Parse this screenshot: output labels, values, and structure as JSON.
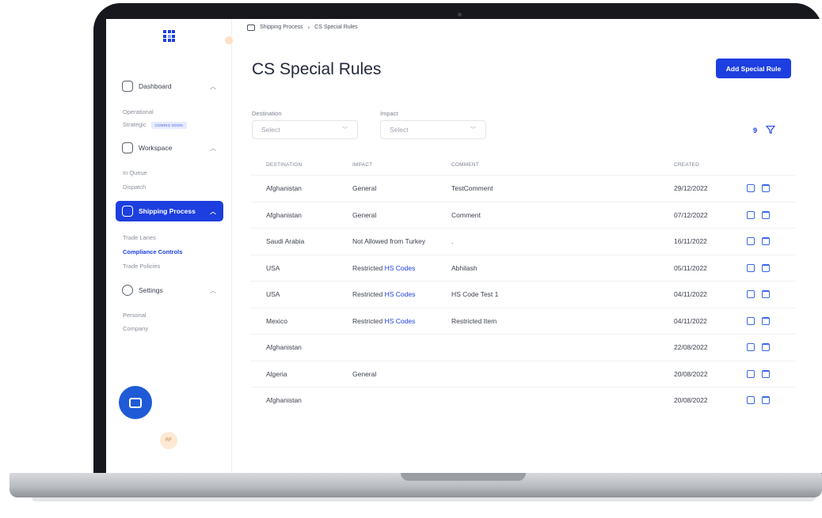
{
  "breadcrumb": {
    "parent": "Shipping Process",
    "current": "CS Special Rules"
  },
  "page": {
    "title": "CS Special Rules",
    "add_button": "Add Special Rule"
  },
  "sidebar": {
    "groups": [
      {
        "label": "Dashboard",
        "icon": "home-icon",
        "items": [
          {
            "label": "Operational"
          },
          {
            "label": "Strategic",
            "badge": "COMING SOON"
          }
        ]
      },
      {
        "label": "Workspace",
        "icon": "document-icon",
        "items": [
          {
            "label": "In Queue"
          },
          {
            "label": "Dispatch"
          }
        ]
      },
      {
        "label": "Shipping Process",
        "icon": "shipping-icon",
        "active": true,
        "items": [
          {
            "label": "Trade Lanes"
          },
          {
            "label": "Compliance Controls",
            "current": true
          },
          {
            "label": "Trade Policies"
          }
        ]
      },
      {
        "label": "Settings",
        "icon": "gear-icon",
        "items": [
          {
            "label": "Personal"
          },
          {
            "label": "Company"
          }
        ]
      }
    ],
    "avatar_initials": "RF"
  },
  "filters": {
    "destination": {
      "label": "Destination",
      "placeholder": "Select"
    },
    "impact": {
      "label": "Impact",
      "placeholder": "Select"
    },
    "count": "9"
  },
  "table": {
    "headers": [
      "DESTINATION",
      "IMPACT",
      "COMMENT",
      "CREATED"
    ],
    "rows": [
      {
        "destination": "Afghanistan",
        "impact": "General",
        "impact_link": "",
        "comment": "TestComment",
        "created": "29/12/2022"
      },
      {
        "destination": "Afghanistan",
        "impact": "General",
        "impact_link": "",
        "comment": "Comment",
        "created": "07/12/2022"
      },
      {
        "destination": "Saudi Arabia",
        "impact": "Not Allowed from Turkey",
        "impact_link": "",
        "comment": ".",
        "created": "16/11/2022"
      },
      {
        "destination": "USA",
        "impact": "Restricted ",
        "impact_link": "HS Codes",
        "comment": "Abhilash",
        "created": "05/11/2022"
      },
      {
        "destination": "USA",
        "impact": "Restricted ",
        "impact_link": "HS Codes",
        "comment": "HS Code Test 1",
        "created": "04/11/2022"
      },
      {
        "destination": "Mexico",
        "impact": "Restricted ",
        "impact_link": "HS Codes",
        "comment": "Restricted Item",
        "created": "04/11/2022"
      },
      {
        "destination": "Afghanistan",
        "impact": "",
        "impact_link": "",
        "comment": "",
        "created": "22/08/2022"
      },
      {
        "destination": "Algeria",
        "impact": "General",
        "impact_link": "",
        "comment": "",
        "created": "20/08/2022"
      },
      {
        "destination": "Afghanistan",
        "impact": "",
        "impact_link": "",
        "comment": "",
        "created": "20/08/2022"
      }
    ]
  },
  "colors": {
    "accent": "#1d3fe0",
    "frame": "#16181d"
  }
}
